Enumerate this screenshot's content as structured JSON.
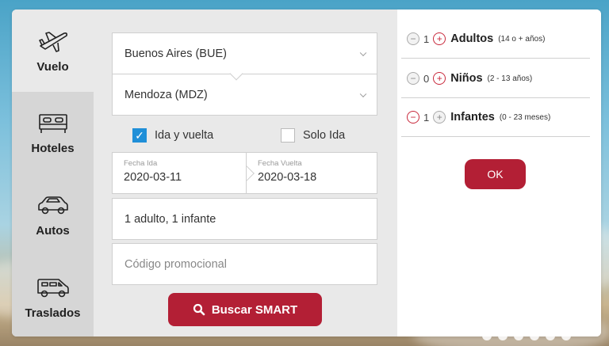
{
  "sidebar": {
    "items": [
      {
        "label": "Vuelo",
        "icon": "plane-icon"
      },
      {
        "label": "Hoteles",
        "icon": "bed-icon"
      },
      {
        "label": "Autos",
        "icon": "car-icon"
      },
      {
        "label": "Traslados",
        "icon": "van-icon"
      }
    ]
  },
  "form": {
    "origin": "Buenos Aires (BUE)",
    "destination": "Mendoza (MDZ)",
    "trip_round": {
      "label": "Ida y vuelta",
      "checked": true
    },
    "trip_one_way": {
      "label": "Solo Ida",
      "checked": false
    },
    "depart_label": "Fecha Ida",
    "depart_value": "2020-03-11",
    "return_label": "Fecha Vuelta",
    "return_value": "2020-03-18",
    "passengers_summary": "1 adulto, 1 infante",
    "promo_placeholder": "Código promocional",
    "search_label": "Buscar SMART"
  },
  "passengers": {
    "rows": [
      {
        "count": "1",
        "label": "Adultos",
        "hint": "(14 o + años)"
      },
      {
        "count": "0",
        "label": "Niños",
        "hint": "(2 - 13 años)"
      },
      {
        "count": "1",
        "label": "Infantes",
        "hint": "(0 - 23 meses)"
      }
    ],
    "ok_label": "OK"
  },
  "colors": {
    "accent": "#b31f35",
    "checkbox": "#1f8fd8",
    "sidebar": "#d6d6d6",
    "panel": "#e9e9e9"
  }
}
